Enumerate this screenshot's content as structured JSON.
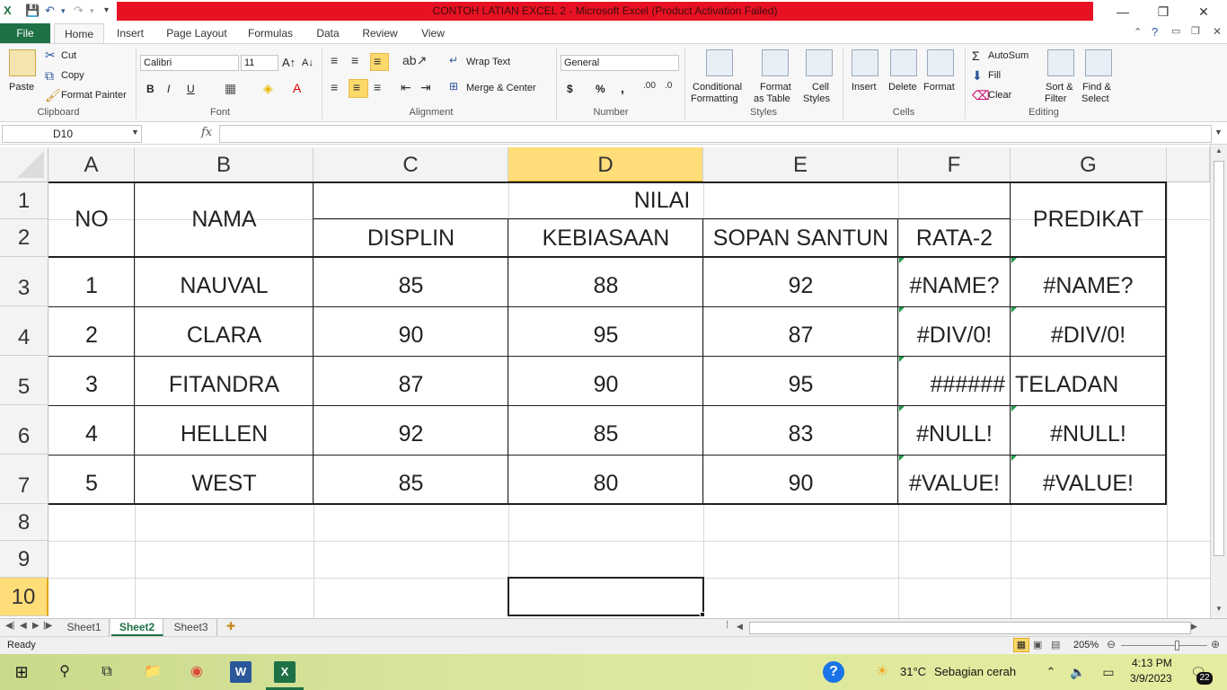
{
  "window": {
    "title": "CONTOH LATIAN EXCEL 2  -  Microsoft Excel (Product Activation Failed)"
  },
  "ribbon": {
    "file_tab": "File",
    "tabs": [
      "Home",
      "Insert",
      "Page Layout",
      "Formulas",
      "Data",
      "Review",
      "View"
    ],
    "active_tab": "Home",
    "clipboard": {
      "paste": "Paste",
      "cut": "Cut",
      "copy": "Copy",
      "format_painter": "Format Painter",
      "label": "Clipboard"
    },
    "font": {
      "name": "Calibri",
      "size": "11",
      "bold": "B",
      "italic": "I",
      "underline": "U",
      "label": "Font"
    },
    "alignment": {
      "wrap_text": "Wrap Text",
      "merge_center": "Merge & Center",
      "label": "Alignment"
    },
    "number": {
      "format": "General",
      "currency": "$",
      "percent": "%",
      "comma": ",",
      "label": "Number"
    },
    "styles": {
      "conditional": "Conditional",
      "conditional2": "Formatting",
      "format_table": "Format",
      "format_table2": "as Table",
      "cell_styles": "Cell",
      "cell_styles2": "Styles",
      "label": "Styles"
    },
    "cells": {
      "insert": "Insert",
      "delete": "Delete",
      "format": "Format",
      "label": "Cells"
    },
    "editing": {
      "autosum": "AutoSum",
      "fill": "Fill",
      "clear": "Clear",
      "sort": "Sort &",
      "sort2": "Filter",
      "find": "Find &",
      "find2": "Select",
      "label": "Editing"
    }
  },
  "formula_bar": {
    "name_box": "D10",
    "fx": "fx",
    "formula": ""
  },
  "sheet": {
    "columns": [
      "A",
      "B",
      "C",
      "D",
      "E",
      "F",
      "G"
    ],
    "rows": [
      "1",
      "2",
      "3",
      "4",
      "5",
      "6",
      "7",
      "8",
      "9",
      "10"
    ],
    "selected_column": "D",
    "selected_row": "10",
    "header": {
      "no": "NO",
      "nama": "NAMA",
      "nilai": "NILAI",
      "displin": "DISPLIN",
      "kebiasaan": "KEBIASAAN",
      "sopan_santun": "SOPAN SANTUN",
      "rata2": "RATA-2",
      "predikat": "PREDIKAT"
    },
    "data_rows": [
      {
        "no": "1",
        "nama": "NAUVAL",
        "displin": "85",
        "kebiasaan": "88",
        "sopan": "92",
        "rata": "#NAME?",
        "predikat": "#NAME?"
      },
      {
        "no": "2",
        "nama": "CLARA",
        "displin": "90",
        "kebiasaan": "95",
        "sopan": "87",
        "rata": "#DIV/0!",
        "predikat": "#DIV/0!"
      },
      {
        "no": "3",
        "nama": "FITANDRA",
        "displin": "87",
        "kebiasaan": "90",
        "sopan": "95",
        "rata": "######",
        "predikat": "TELADAN"
      },
      {
        "no": "4",
        "nama": "HELLEN",
        "displin": "92",
        "kebiasaan": "85",
        "sopan": "83",
        "rata": "#NULL!",
        "predikat": "#NULL!"
      },
      {
        "no": "5",
        "nama": "WEST",
        "displin": "85",
        "kebiasaan": "80",
        "sopan": "90",
        "rata": "#VALUE!",
        "predikat": "#VALUE!"
      }
    ]
  },
  "sheet_tabs": [
    "Sheet1",
    "Sheet2",
    "Sheet3"
  ],
  "active_sheet": "Sheet2",
  "status": {
    "ready": "Ready",
    "zoom": "205%"
  },
  "taskbar": {
    "weather_temp": "31°C",
    "weather_text": "Sebagian cerah",
    "time": "4:13 PM",
    "date": "3/9/2023",
    "notifications": "22"
  },
  "colors": {
    "excel_green": "#1e7145",
    "title_red": "#e81123",
    "selection_header": "#ffdd79"
  }
}
